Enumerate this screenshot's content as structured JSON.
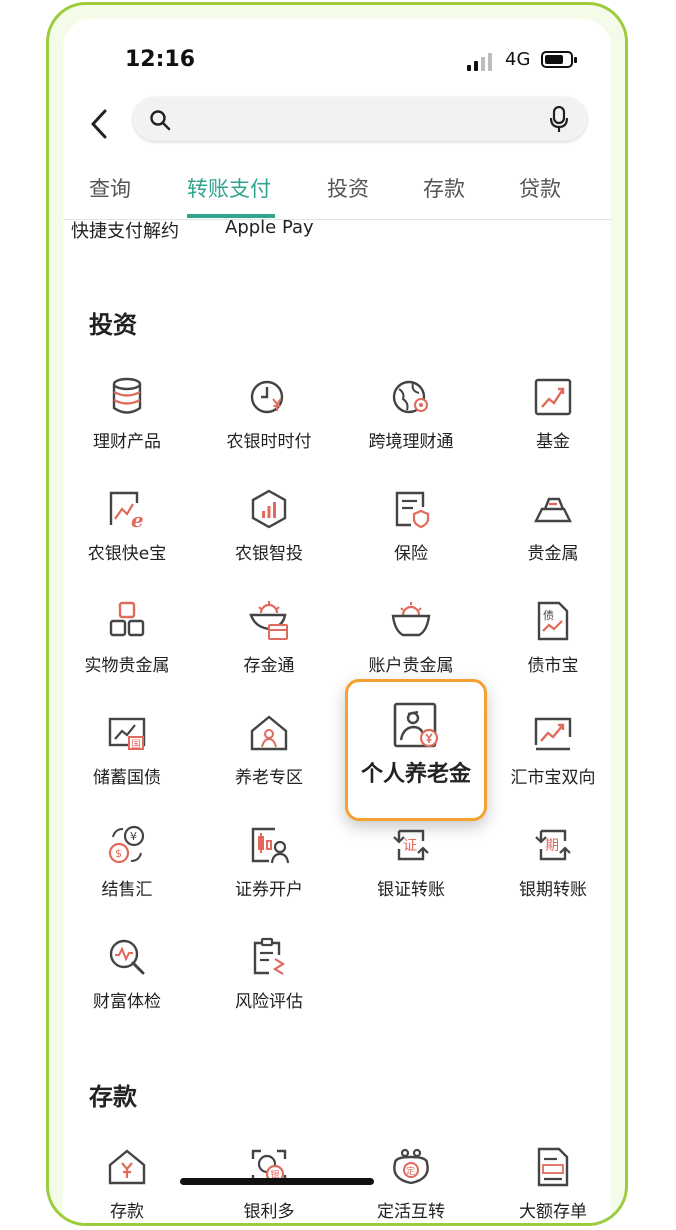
{
  "status_bar": {
    "time": "12:16",
    "network": "4G"
  },
  "tabs": [
    {
      "label": "查询"
    },
    {
      "label": "转账支付"
    },
    {
      "label": "投资"
    },
    {
      "label": "存款"
    },
    {
      "label": "贷款"
    }
  ],
  "active_tab": "转账支付",
  "quick_links": [
    {
      "label": "快捷支付解约"
    },
    {
      "label": "Apple Pay"
    }
  ],
  "investment": {
    "title": "投资",
    "items": [
      {
        "label": "理财产品",
        "icon": "coin-stack-icon"
      },
      {
        "label": "农银时时付",
        "icon": "clock-yuan-icon"
      },
      {
        "label": "跨境理财通",
        "icon": "globe-icon"
      },
      {
        "label": "基金",
        "icon": "trend-chart-icon"
      },
      {
        "label": "农银快e宝",
        "icon": "chart-e-icon"
      },
      {
        "label": "农银智投",
        "icon": "hexagon-bars-icon"
      },
      {
        "label": "保险",
        "icon": "insurance-doc-icon"
      },
      {
        "label": "贵金属",
        "icon": "gold-bar-icon"
      },
      {
        "label": "实物贵金属",
        "icon": "gold-blocks-icon"
      },
      {
        "label": "存金通",
        "icon": "gold-bowl-card-icon"
      },
      {
        "label": "账户贵金属",
        "icon": "gold-bowl-icon"
      },
      {
        "label": "债市宝",
        "icon": "bond-doc-icon"
      },
      {
        "label": "储蓄国债",
        "icon": "treasury-bond-icon"
      },
      {
        "label": "养老专区",
        "icon": "pension-house-icon"
      },
      {
        "label": "个人养老金",
        "icon": "pension-person-icon"
      },
      {
        "label": "汇市宝双向",
        "icon": "fx-chart-icon"
      },
      {
        "label": "结售汇",
        "icon": "currency-exchange-icon"
      },
      {
        "label": "证券开户",
        "icon": "securities-account-icon"
      },
      {
        "label": "银证转账",
        "icon": "bank-securities-transfer-icon"
      },
      {
        "label": "银期转账",
        "icon": "bank-futures-transfer-icon"
      },
      {
        "label": "财富体检",
        "icon": "wealth-checkup-icon"
      },
      {
        "label": "风险评估",
        "icon": "risk-assessment-icon"
      }
    ]
  },
  "deposit": {
    "title": "存款",
    "items": [
      {
        "label": "存款",
        "icon": "deposit-house-icon"
      },
      {
        "label": "银利多",
        "icon": "coin-scan-icon"
      },
      {
        "label": "定活互转",
        "icon": "purse-icon"
      },
      {
        "label": "大额存单",
        "icon": "large-deposit-icon"
      }
    ]
  },
  "colors": {
    "accent": "#2fa58f",
    "icon_dark": "#444444",
    "icon_red": "#e06a5c",
    "highlight_border": "#f5a030",
    "frame": "#9ccc3c"
  }
}
